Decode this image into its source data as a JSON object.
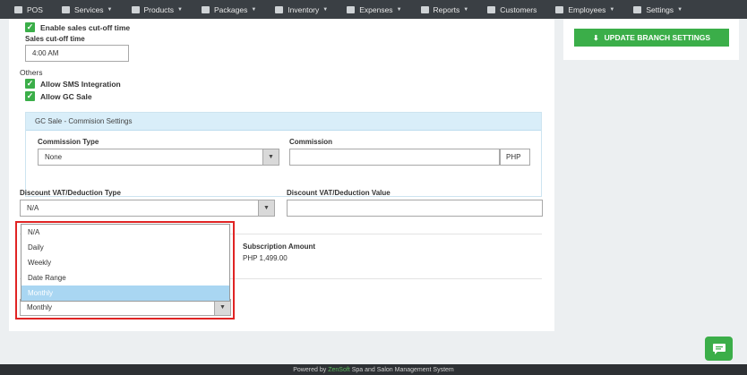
{
  "nav": {
    "items": [
      {
        "label": "POS",
        "icon": "pos-icon",
        "caret": false
      },
      {
        "label": "Services",
        "icon": "services-icon",
        "caret": true
      },
      {
        "label": "Products",
        "icon": "products-icon",
        "caret": true
      },
      {
        "label": "Packages",
        "icon": "packages-icon",
        "caret": true
      },
      {
        "label": "Inventory",
        "icon": "inventory-icon",
        "caret": true
      },
      {
        "label": "Expenses",
        "icon": "expenses-icon",
        "caret": true
      },
      {
        "label": "Reports",
        "icon": "reports-icon",
        "caret": true
      },
      {
        "label": "Customers",
        "icon": "customers-icon",
        "caret": false
      },
      {
        "label": "Employees",
        "icon": "employees-icon",
        "caret": true
      },
      {
        "label": "Settings",
        "icon": "settings-icon",
        "caret": true
      }
    ]
  },
  "form": {
    "enable_cutoff_label": "Enable sales cut-off time",
    "cutoff_time_label": "Sales cut-off time",
    "cutoff_time_value": "4:00 AM",
    "others_label": "Others",
    "allow_sms_label": "Allow SMS Integration",
    "allow_gc_label": "Allow GC Sale",
    "gc_header": "GC Sale - Commision Settings",
    "commission_type_label": "Commission Type",
    "commission_type_value": "None",
    "commission_label": "Commission",
    "commission_value": "",
    "commission_unit": "PHP",
    "vat_type_label": "Discount VAT/Deduction Type",
    "vat_type_value": "N/A",
    "vat_value_label": "Discount VAT/Deduction Value",
    "vat_value_value": "",
    "subscription_amount_label": "Subscription Amount",
    "subscription_amount_value": "PHP 1,499.00",
    "frequency_value": "Monthly"
  },
  "dropdown": {
    "options": [
      "N/A",
      "Daily",
      "Weekly",
      "Date Range",
      "Monthly"
    ],
    "selected": "Monthly"
  },
  "sidebar": {
    "update_button_label": "UPDATE BRANCH SETTINGS"
  },
  "footer": {
    "prefix": "Powered by",
    "brand": "ZenSoft",
    "suffix": "Spa and Salon Management System"
  },
  "colors": {
    "nav_bg": "#3a3f44",
    "accent_green": "#3bae49",
    "highlight_red": "#e02424",
    "selected_blue": "#a9d6f2"
  }
}
